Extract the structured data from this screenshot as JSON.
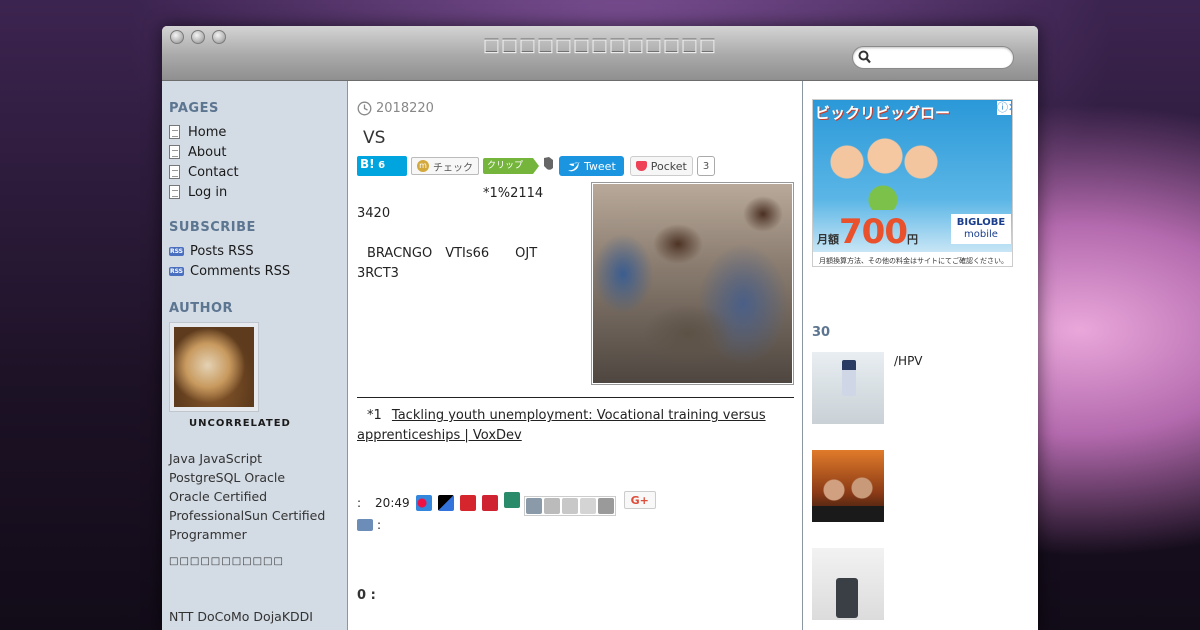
{
  "window": {
    "title": "□□□□□□□□□□□□□",
    "search_placeholder": ""
  },
  "sidebar": {
    "pages_heading": "PAGES",
    "pages": [
      "Home",
      "About",
      "Contact",
      "Log in"
    ],
    "subscribe_heading": "SUBSCRIBE",
    "feeds": [
      "Posts RSS",
      "Comments RSS"
    ],
    "rss_badge": "RSS",
    "author_heading": "AUTHOR",
    "author_name": "UNCORRELATED",
    "author_bio": [
      "Java JavaScript",
      "PostgreSQL Oracle",
      "Oracle Certified",
      "ProfessionalSun Certified",
      "Programmer"
    ],
    "author_glyphs": "□□□□□□□□□□□",
    "more_text": "NTT DoCoMo DojaKDDI"
  },
  "post": {
    "date": "2018220",
    "title": "VS",
    "share": {
      "hatena_mark": "B!",
      "hatena_count": "6",
      "mixi_mark": "m",
      "mixi_label": "チェック",
      "clip_label": "クリップ",
      "tweet_label": "Tweet",
      "pocket_label": "Pocket",
      "pocket_count": "3"
    },
    "body_line1": "*1%2114",
    "body_line2": "3420",
    "body_line3": "BRACNGO　VTIs66　　OJT",
    "body_line4": "3RCT3",
    "footnote_mark": "*1",
    "footnote_link": "Tackling youth unemployment: Vocational training versus apprenticeships | VoxDev",
    "meta_prefix": ":",
    "time": "20:49",
    "gplus_label": "G+",
    "category_prefix": ":",
    "comments": "0 :"
  },
  "right": {
    "ad_headline": "ビックリビッグロー",
    "ad_price": "700",
    "ad_price_unit": "円",
    "ad_price_prefix": "月額",
    "ad_brand_line1": "BIGLOBE",
    "ad_brand_line2": "mobile",
    "ad_note": "月額換算方法、その他の料金はサイトにてご確認ください。",
    "ad_close": "ⓘ✕",
    "ranking_heading": "30",
    "ranking_items": [
      {
        "label": "/HPV"
      },
      {
        "label": ""
      },
      {
        "label": ""
      }
    ]
  },
  "colors": {
    "heading": "#5c7590",
    "sidebar_bg": "#d3dbe4",
    "tweet": "#1b95e0",
    "hatena": "#00a4de",
    "pocket": "#ee4056"
  }
}
